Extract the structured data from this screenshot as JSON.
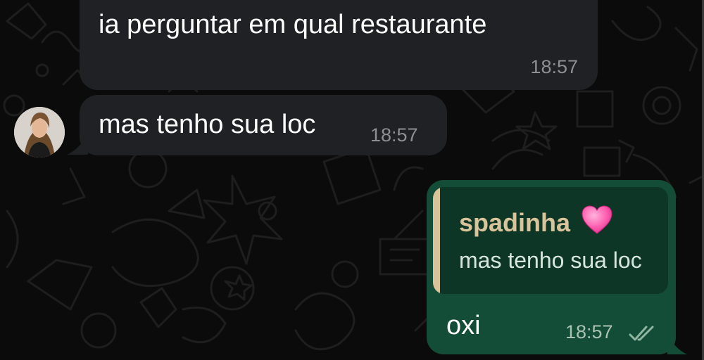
{
  "messages": {
    "m1": {
      "text": "ia perguntar em qual restaurante",
      "time": "18:57"
    },
    "m2": {
      "text": "mas tenho sua loc",
      "time": "18:57"
    },
    "reply": {
      "quoted_author": "spadinha",
      "quoted_author_emoji": "pink-heart",
      "quoted_text": "mas tenho sua loc",
      "text": "oxi",
      "time": "18:57",
      "status": "read"
    }
  },
  "colors": {
    "incoming_bubble": "#202124",
    "outgoing_bubble": "#144d37",
    "quote_accent": "#d9c39a",
    "read_ticks": "#8fb6a2"
  }
}
